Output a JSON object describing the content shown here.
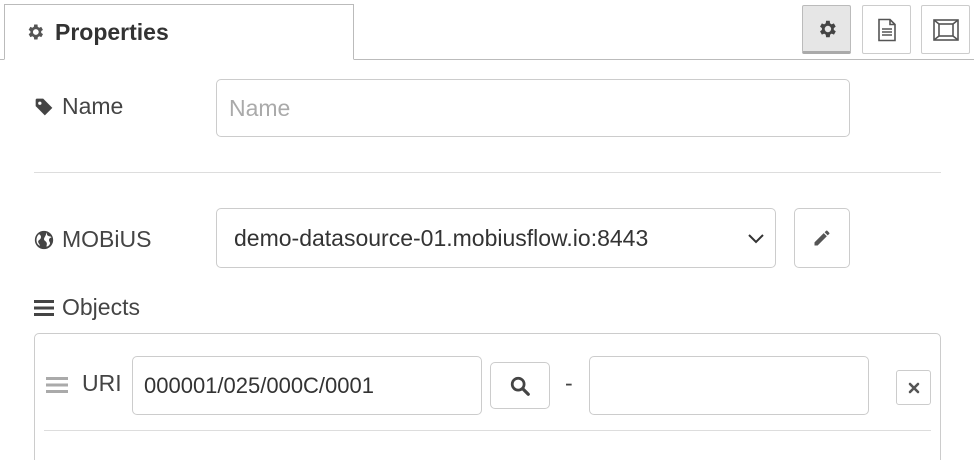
{
  "tabs": {
    "properties_label": "Properties"
  },
  "toolbar": {
    "settings_icon": "gear-icon",
    "description_icon": "document-icon",
    "appearance_icon": "frame-icon"
  },
  "form": {
    "name_label": "Name",
    "name_placeholder": "Name",
    "name_value": "",
    "mobius_label": "MOBiUS",
    "mobius_selected": "demo-datasource-01.mobiusflow.io:8443",
    "objects_label": "Objects"
  },
  "objects": {
    "rows": [
      {
        "uri_label": "URI",
        "uri_value": "000001/025/000C/0001",
        "separator": "-",
        "extra_value": ""
      }
    ]
  },
  "colors": {
    "text": "#333333",
    "border": "#cccccc",
    "active_bg": "#e6e6e6"
  }
}
